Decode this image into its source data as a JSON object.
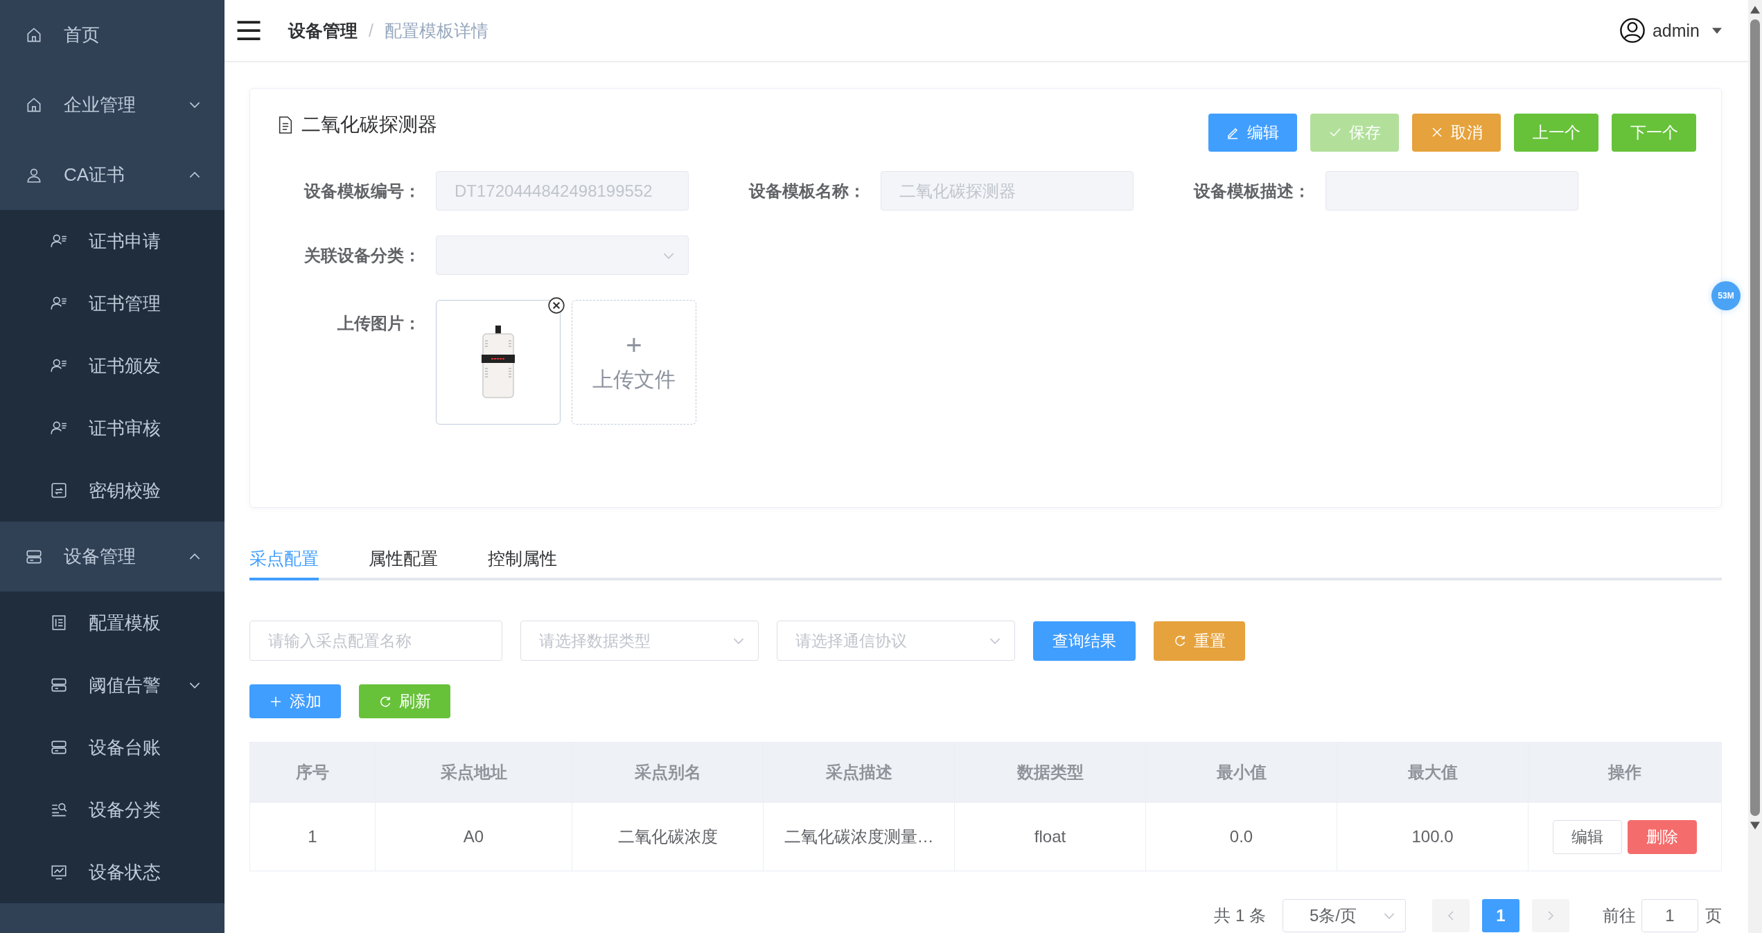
{
  "sidebar": {
    "items": [
      {
        "label": "首页",
        "kind": "link"
      },
      {
        "label": "企业管理",
        "kind": "group",
        "expanded": false
      },
      {
        "label": "CA证书",
        "kind": "group",
        "expanded": true,
        "children": [
          {
            "label": "证书申请"
          },
          {
            "label": "证书管理"
          },
          {
            "label": "证书颁发"
          },
          {
            "label": "证书审核"
          },
          {
            "label": "密钥校验"
          }
        ]
      },
      {
        "label": "设备管理",
        "kind": "group",
        "expanded": true,
        "children": [
          {
            "label": "配置模板"
          },
          {
            "label": "阈值告警",
            "kind": "group",
            "expanded": false
          },
          {
            "label": "设备台账"
          },
          {
            "label": "设备分类"
          },
          {
            "label": "设备状态"
          }
        ]
      }
    ]
  },
  "header": {
    "breadcrumb": [
      "设备管理",
      "配置模板详情"
    ],
    "separator": "/",
    "user": "admin"
  },
  "detail": {
    "title": "二氧化碳探测器",
    "buttons": [
      {
        "label": "编辑",
        "kind": "primary",
        "disabled": false
      },
      {
        "label": "保存",
        "kind": "success",
        "disabled": true
      },
      {
        "label": "取消",
        "kind": "warning",
        "disabled": false
      },
      {
        "label": "上一个",
        "kind": "success",
        "disabled": false
      },
      {
        "label": "下一个",
        "kind": "success",
        "disabled": false
      }
    ],
    "fields": [
      {
        "label": "设备模板编号：",
        "kind": "input",
        "value": "DT1720444842498199552",
        "disabled": true
      },
      {
        "label": "设备模板名称：",
        "kind": "input",
        "value": "二氧化碳探测器",
        "disabled": true
      },
      {
        "label": "设备模板描述：",
        "kind": "input",
        "disabled": true
      },
      {
        "label": "关联设备分类：",
        "kind": "select",
        "disabled": true
      }
    ],
    "upload": {
      "label": "上传图片：",
      "button": "上传文件",
      "plus": "+"
    }
  },
  "badge": "53M",
  "tabs": [
    {
      "label": "采点配置",
      "selected": true
    },
    {
      "label": "属性配置",
      "selected": false
    },
    {
      "label": "控制属性",
      "selected": false
    }
  ],
  "filters": [
    {
      "kind": "input",
      "placeholder": "请输入采点配置名称"
    },
    {
      "kind": "select",
      "placeholder": "请选择数据类型"
    },
    {
      "kind": "select",
      "placeholder": "请选择通信协议"
    }
  ],
  "filter_buttons": [
    {
      "label": "查询结果",
      "kind": "primary"
    },
    {
      "label": "重置",
      "kind": "warning"
    }
  ],
  "action_buttons": [
    {
      "label": "添加",
      "kind": "primary"
    },
    {
      "label": "刷新",
      "kind": "success"
    }
  ],
  "table": {
    "columns": [
      "序号",
      "采点地址",
      "采点别名",
      "采点描述",
      "数据类型",
      "最小值",
      "最大值",
      "操作"
    ],
    "rows": [
      {
        "cells": [
          "1",
          "A0",
          "二氧化碳浓度",
          "二氧化碳浓度测量…",
          "float",
          "0.0",
          "100.0"
        ],
        "actions": [
          {
            "label": "编辑",
            "kind": "default"
          },
          {
            "label": "删除",
            "kind": "danger"
          }
        ]
      }
    ]
  },
  "pagination": {
    "total": "共 1 条",
    "page_size": "5条/页",
    "pages": [
      {
        "label": "1",
        "selected": true
      }
    ],
    "goto_label": "前往",
    "goto_value": "1",
    "goto_suffix": "页"
  }
}
